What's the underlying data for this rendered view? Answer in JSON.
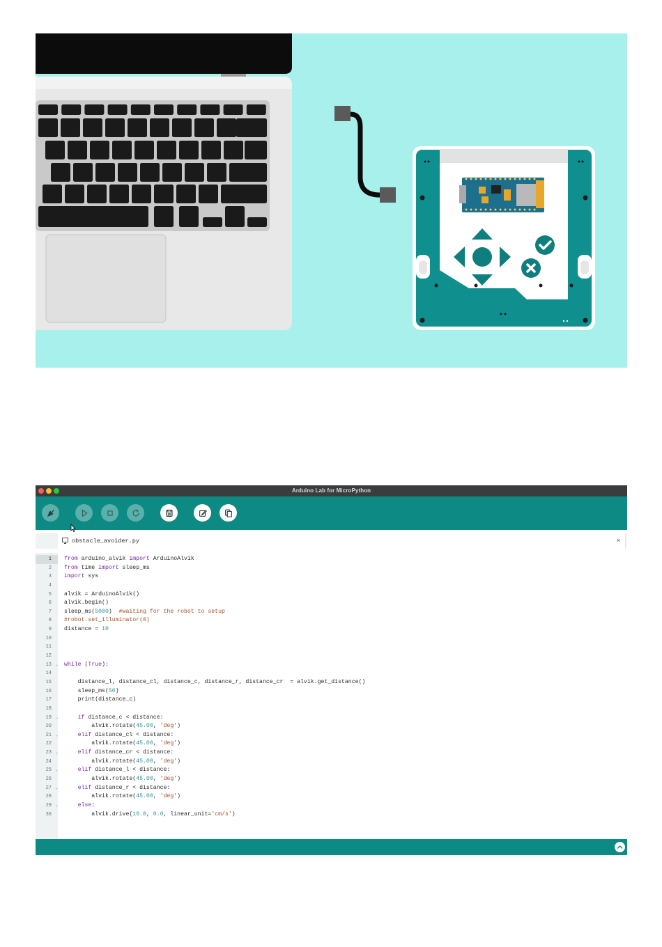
{
  "window": {
    "title": "Arduino Lab for MicroPython"
  },
  "toolbar": {
    "buttons": [
      {
        "name": "connect",
        "icon": "plug-icon",
        "state": "disabled"
      },
      {
        "name": "run",
        "icon": "play-icon",
        "state": "disabled"
      },
      {
        "name": "stop",
        "icon": "stop-icon",
        "state": "disabled"
      },
      {
        "name": "reset",
        "icon": "refresh-icon",
        "state": "disabled"
      },
      {
        "name": "save",
        "icon": "save-icon",
        "state": "active"
      },
      {
        "name": "edit",
        "icon": "edit-icon",
        "state": "active"
      },
      {
        "name": "files",
        "icon": "files-icon",
        "state": "active"
      }
    ]
  },
  "tab": {
    "filename": "obstacle_avoider.py",
    "close_label": "×"
  },
  "editor": {
    "current_line": 1,
    "line_numbers": [
      "1",
      "2",
      "3",
      "4",
      "5",
      "6",
      "7",
      "8",
      "9",
      "10",
      "11",
      "12",
      "13",
      "14",
      "15",
      "16",
      "17",
      "18",
      "19",
      "20",
      "21",
      "22",
      "23",
      "24",
      "25",
      "26",
      "27",
      "28",
      "29",
      "30"
    ],
    "fold_lines": [
      13,
      19,
      21,
      23,
      25,
      27,
      29
    ],
    "lines": [
      "from arduino_alvik import ArduinoAlvik",
      "from time import sleep_ms",
      "import sys",
      "",
      "alvik = ArduinoAlvik()",
      "alvik.begin()",
      "sleep_ms(5000)  #waiting for the robot to setup",
      "#robot.set_illuminator(0)",
      "distance = 10",
      "",
      "",
      "",
      "while (True):",
      "",
      "    distance_l, distance_cl, distance_c, distance_r, distance_cr  = alvik.get_distance()",
      "    sleep_ms(50)",
      "    print(distance_c)",
      "",
      "    if distance_c < distance:",
      "        alvik.rotate(45.00, 'deg')",
      "    elif distance_cl < distance:",
      "        alvik.rotate(45.00, 'deg')",
      "    elif distance_cr < distance:",
      "        alvik.rotate(45.00, 'deg')",
      "    elif distance_l < distance:",
      "        alvik.rotate(45.00, 'deg')",
      "    elif distance_r < distance:",
      "        alvik.rotate(45.00, 'deg')",
      "    else:",
      "        alvik.drive(10.0, 0.0, linear_unit='cm/s')"
    ]
  },
  "statusbar": {
    "toggle_icon": "chevron-up-icon"
  },
  "colors": {
    "accent": "#0e8a84",
    "illustration_bg": "#a8f0ec",
    "robot_teal": "#0f8f8d",
    "keyword": "#7a2aa8",
    "number": "#2f8f96",
    "string": "#a0522d"
  }
}
